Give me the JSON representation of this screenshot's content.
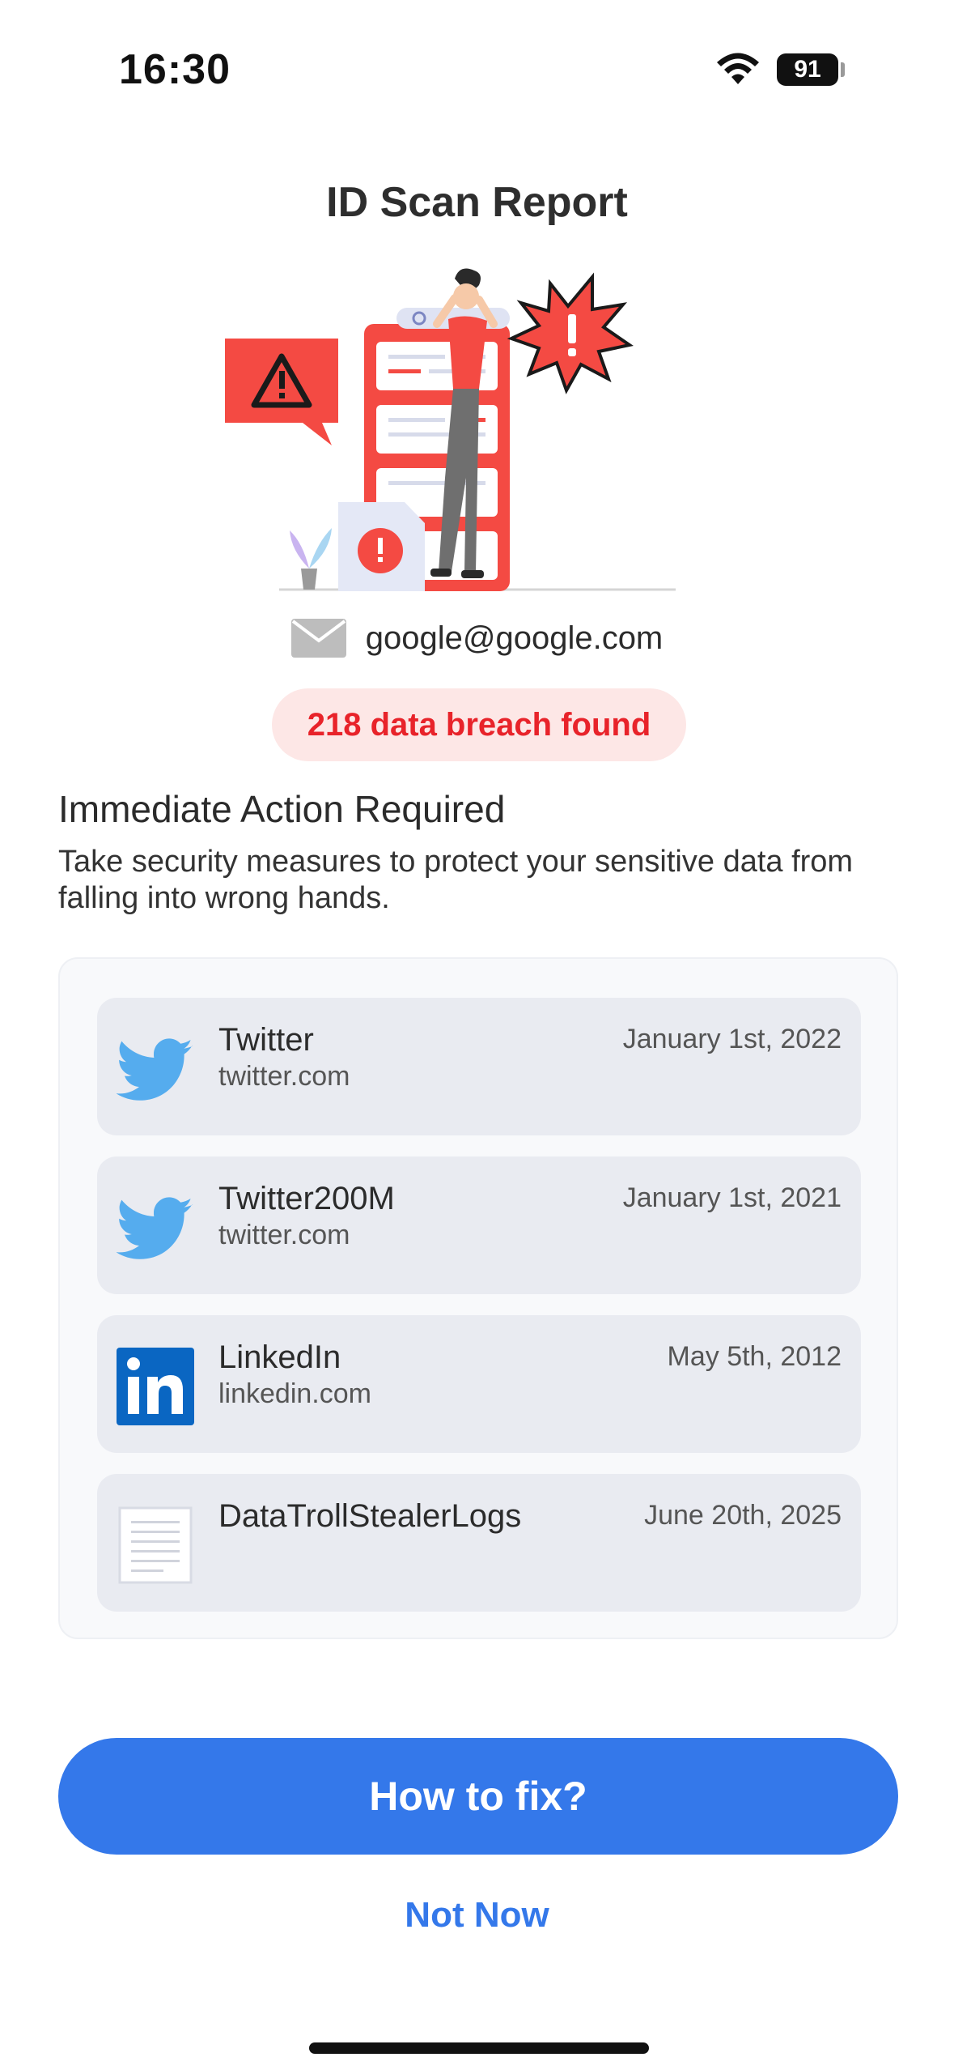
{
  "status_bar": {
    "time": "16:30",
    "battery": "91",
    "icons": [
      "wifi-icon",
      "battery-icon"
    ]
  },
  "header": {
    "title": "ID Scan Report"
  },
  "scan": {
    "email": "google@google.com",
    "breach_count_text": "218 data breach found"
  },
  "action": {
    "heading": "Immediate Action Required",
    "description": "Take security measures to protect your sensitive data from falling into wrong hands."
  },
  "breaches": [
    {
      "name": "Twitter",
      "domain": "twitter.com",
      "date": "January 1st, 2022",
      "icon": "twitter-icon"
    },
    {
      "name": "Twitter200M",
      "domain": "twitter.com",
      "date": "January 1st, 2021",
      "icon": "twitter-icon"
    },
    {
      "name": "LinkedIn",
      "domain": "linkedin.com",
      "date": "May 5th, 2012",
      "icon": "linkedin-icon"
    },
    {
      "name": "DataTrollStealerLogs",
      "domain": "",
      "date": "June 20th, 2025",
      "icon": "document-icon"
    }
  ],
  "buttons": {
    "primary": "How to fix?",
    "secondary": "Not Now"
  },
  "colors": {
    "accent": "#3478ea",
    "danger": "#e8232a",
    "danger_bg": "#fde7e6",
    "illustration_red": "#f44a43"
  }
}
